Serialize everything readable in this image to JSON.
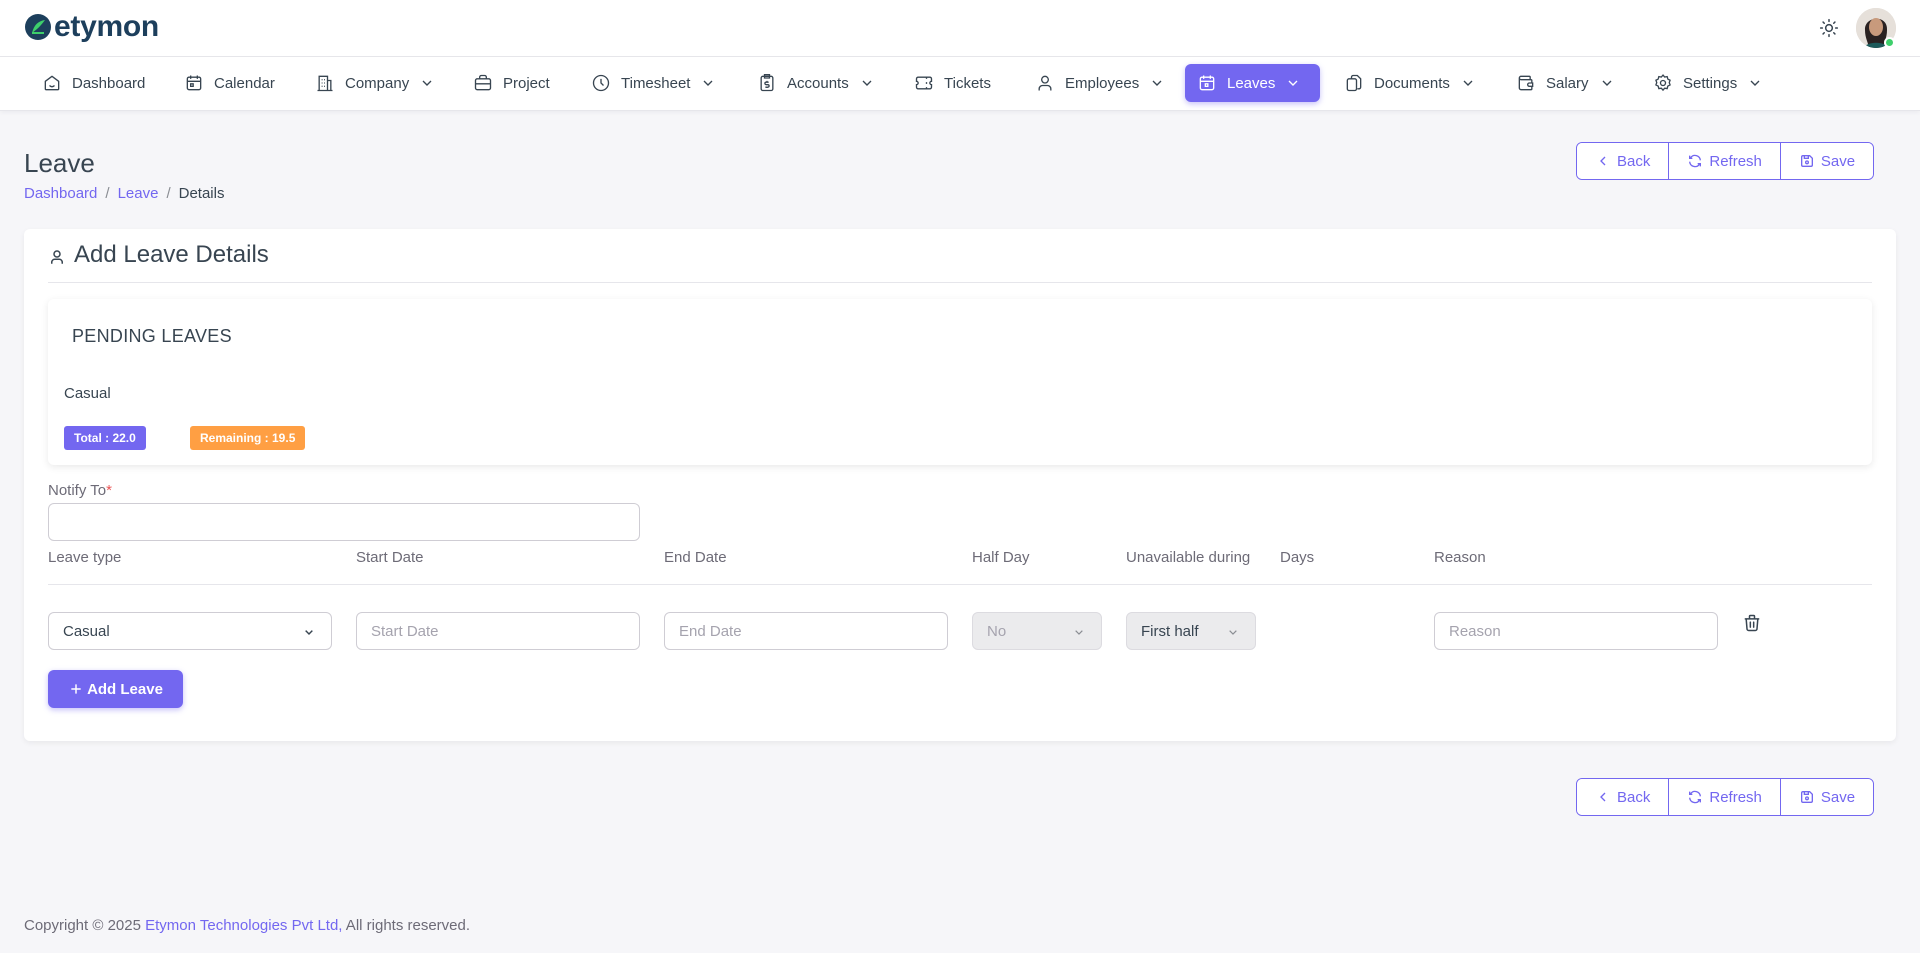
{
  "app": {
    "logo_text": "etymon"
  },
  "nav": [
    {
      "label": "Dashboard",
      "icon": "smart-home-icon",
      "chevron": false,
      "active": false
    },
    {
      "label": "Calendar",
      "icon": "calendar-event-icon",
      "chevron": false,
      "active": false
    },
    {
      "label": "Company",
      "icon": "building-icon",
      "chevron": true,
      "active": false
    },
    {
      "label": "Project",
      "icon": "briefcase-icon",
      "chevron": false,
      "active": false
    },
    {
      "label": "Timesheet",
      "icon": "clock-icon",
      "chevron": true,
      "active": false
    },
    {
      "label": "Accounts",
      "icon": "report-money-icon",
      "chevron": true,
      "active": false
    },
    {
      "label": "Tickets",
      "icon": "ticket-icon",
      "chevron": false,
      "active": false
    },
    {
      "label": "Employees",
      "icon": "user-icon",
      "chevron": true,
      "active": false
    },
    {
      "label": "Leaves",
      "icon": "calendar-icon",
      "chevron": true,
      "active": true
    },
    {
      "label": "Documents",
      "icon": "files-icon",
      "chevron": true,
      "active": false
    },
    {
      "label": "Salary",
      "icon": "wallet-icon",
      "chevron": true,
      "active": false
    },
    {
      "label": "Settings",
      "icon": "settings-icon",
      "chevron": true,
      "active": false
    }
  ],
  "page": {
    "title": "Leave",
    "breadcrumb": {
      "home": "Dashboard",
      "section": "Leave",
      "current": "Details",
      "separator": "/"
    }
  },
  "actions": {
    "back": "Back",
    "refresh": "Refresh",
    "save": "Save"
  },
  "card": {
    "title": "Add Leave Details",
    "pending": {
      "title": "PENDING LEAVES",
      "type": "Casual",
      "total": "Total : 22.0",
      "remaining": "Remaining : 19.5"
    },
    "notify": {
      "label": "Notify To",
      "required_mark": "*",
      "value": ""
    },
    "columns": {
      "leave_type": "Leave type",
      "start_date": "Start Date",
      "end_date": "End Date",
      "half_day": "Half Day",
      "unavailable": "Unavailable during",
      "days": "Days",
      "reason": "Reason"
    },
    "row": {
      "leave_type": "Casual",
      "start_placeholder": "Start Date",
      "end_placeholder": "End Date",
      "half_day": "No",
      "unavailable": "First half",
      "days": "",
      "reason_placeholder": "Reason"
    },
    "add_button": "Add Leave"
  },
  "footer": {
    "prefix": "Copyright © 2025 ",
    "company": "Etymon Technologies Pvt Ltd,",
    "suffix": " All rights reserved."
  },
  "colors": {
    "primary": "#7367f0",
    "warning": "#ff9f43",
    "online": "#3ecf6b",
    "danger": "#ea5455"
  }
}
